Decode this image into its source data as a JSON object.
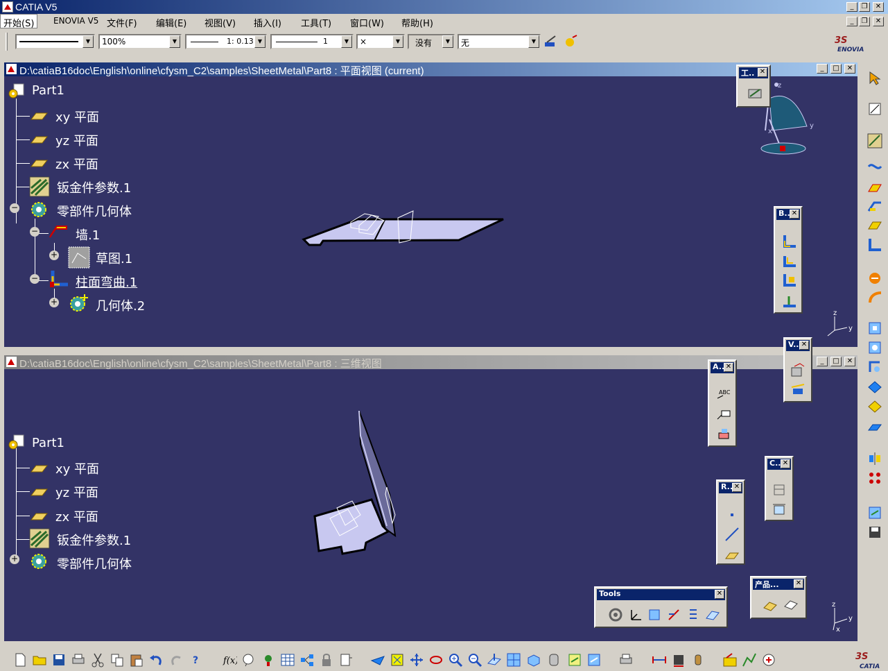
{
  "app": {
    "title": "CATIA V5"
  },
  "menu": [
    {
      "label": "开始(S)"
    },
    {
      "label": "ENOVIA V5"
    },
    {
      "label": "文件(F)"
    },
    {
      "label": "编辑(E)"
    },
    {
      "label": "视图(V)"
    },
    {
      "label": "插入(I)"
    },
    {
      "label": "工具(T)"
    },
    {
      "label": "窗口(W)"
    },
    {
      "label": "帮助(H)"
    }
  ],
  "toolbar": {
    "color_value": "",
    "transparency_value": "100%",
    "linetype_scale": "1: 0.13",
    "line_weight": "1",
    "point_symbol": "×",
    "layer_value": "没有",
    "filter_value": "无"
  },
  "window1": {
    "title": "D:\\catiaB16doc\\English\\online\\cfysm_C2\\samples\\SheetMetal\\Part8 : 平面视图 (current)",
    "tree": {
      "root": "Part1",
      "xy": "xy 平面",
      "yz": "yz 平面",
      "zx": "zx 平面",
      "params": "钣金件参数.1",
      "geom": "零部件几何体",
      "wall": "墙.1",
      "sketch": "草图.1",
      "bend": "柱面弯曲.1",
      "body2": "几何体.2"
    }
  },
  "window2": {
    "title": "D:\\catiaB16doc\\English\\online\\cfysm_C2\\samples\\SheetMetal\\Part8 : 三维视图",
    "tree": {
      "root": "Part1",
      "xy": "xy 平面",
      "yz": "yz 平面",
      "zx": "zx 平面",
      "params": "钣金件参数.1",
      "geom": "零部件几何体"
    }
  },
  "palettes": {
    "tools_top": "工..",
    "bend": "B..",
    "views": "V..",
    "annot": "A..",
    "constraint": "C..",
    "reference": "R..",
    "tools": "Tools",
    "product": "产品..."
  },
  "compass_labels": {
    "z": "z",
    "x": "x",
    "y": "y"
  },
  "axes_labels": {
    "z": "z",
    "y": "y",
    "x": "x"
  },
  "colors": {
    "background": "#333366",
    "part": "#c8c8f0",
    "titlebar": "#0a246a"
  }
}
